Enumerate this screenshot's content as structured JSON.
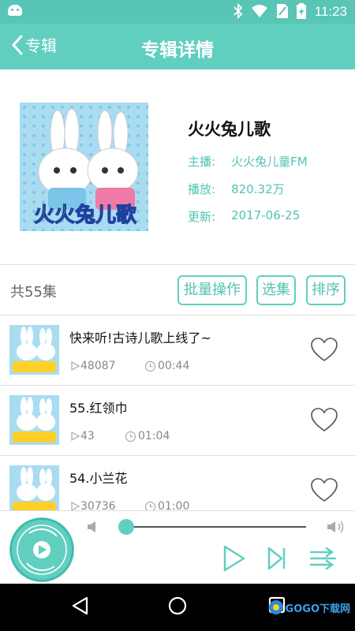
{
  "status": {
    "time": "11:23"
  },
  "appbar": {
    "back_label": "专辑",
    "title": "专辑详情"
  },
  "album": {
    "name": "火火兔儿歌",
    "host_label": "主播:",
    "host": "火火兔儿童FM",
    "plays_label": "播放:",
    "plays": "820.32万",
    "updated_label": "更新:",
    "updated": "2017-06-25",
    "cover_text": "火火兔儿歌"
  },
  "toolbar": {
    "count": "共55集",
    "batch": "批量操作",
    "select": "选集",
    "sort": "排序"
  },
  "tracks": [
    {
      "title": "快来听!古诗儿歌上线了~",
      "plays": "48087",
      "duration": "00:44"
    },
    {
      "title": "55.红领巾",
      "plays": "43",
      "duration": "01:04"
    },
    {
      "title": "54.小兰花",
      "plays": "30736",
      "duration": "01:00"
    }
  ],
  "player": {
    "progress": 0.0
  },
  "watermark": {
    "text": "GOGO下载网"
  },
  "colors": {
    "accent": "#61cfc0",
    "accent_text": "#4fc3b4"
  }
}
